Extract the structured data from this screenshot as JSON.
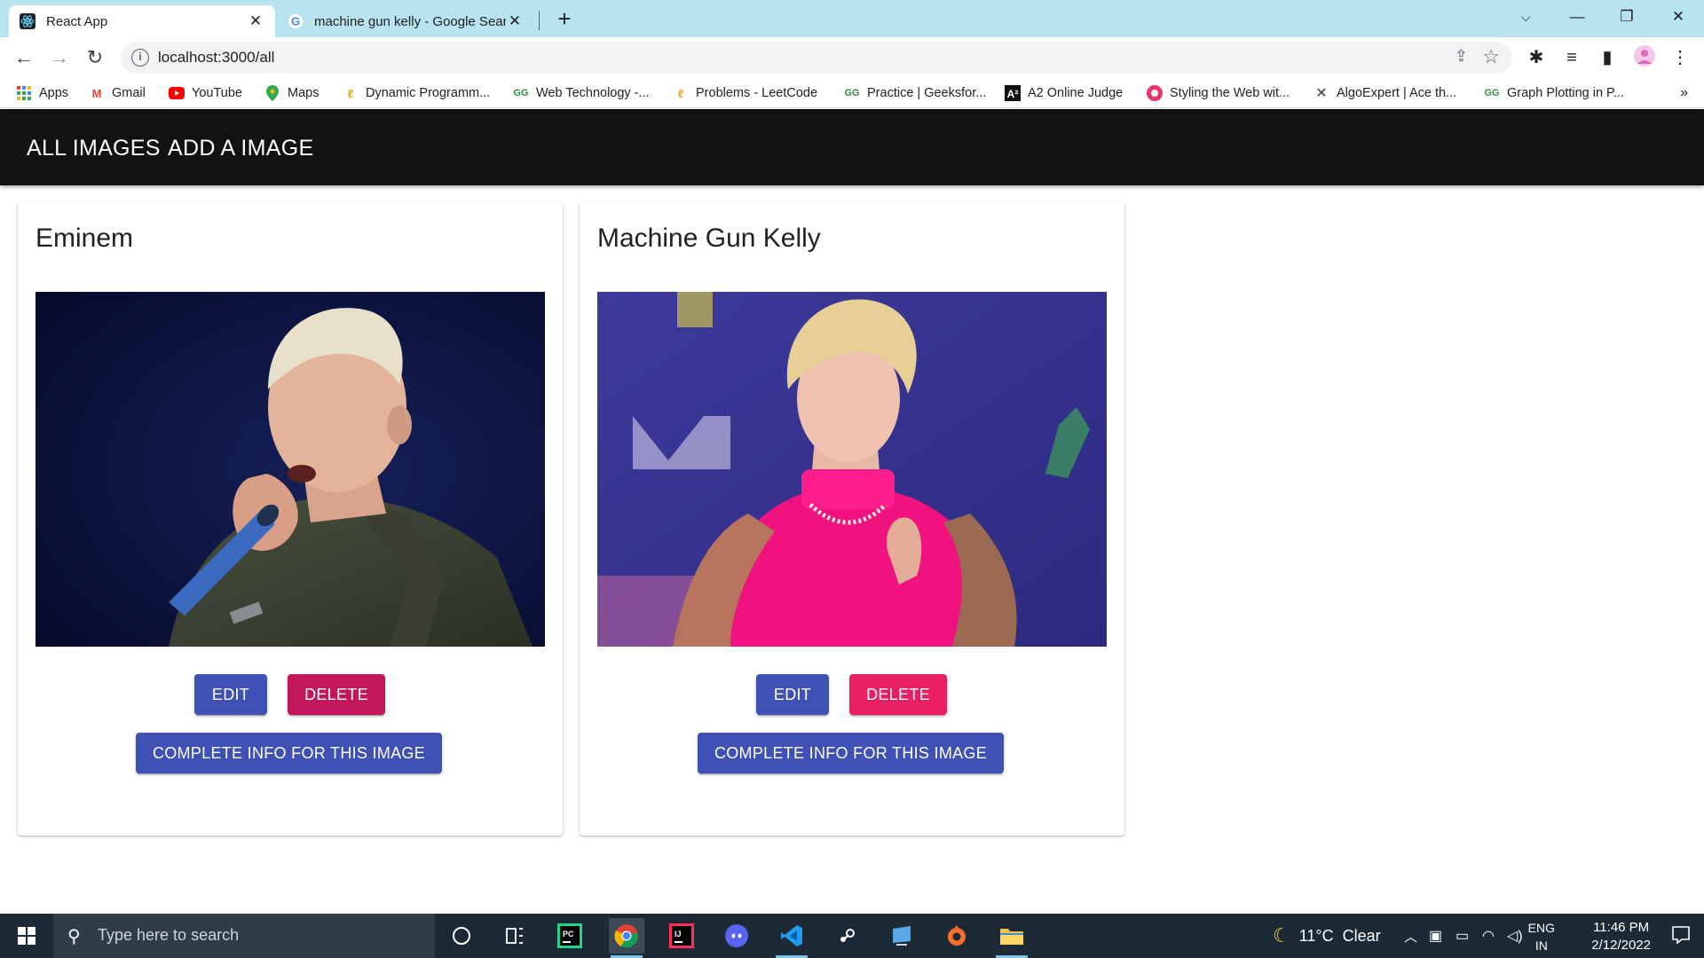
{
  "browser": {
    "tabs": [
      {
        "title": "React App",
        "favicon": "react-icon"
      },
      {
        "title": "machine gun kelly - Google Search",
        "favicon": "google-icon"
      }
    ],
    "new_tab_label": "+",
    "url": "localhost:3000/all",
    "bookmarks": [
      {
        "label": "Apps",
        "icon": "apps-grid-icon"
      },
      {
        "label": "Gmail",
        "icon": "gmail-icon"
      },
      {
        "label": "YouTube",
        "icon": "youtube-icon"
      },
      {
        "label": "Maps",
        "icon": "maps-icon"
      },
      {
        "label": "Dynamic Programm...",
        "icon": "leetcode-icon"
      },
      {
        "label": "Web Technology -...",
        "icon": "gfg-icon"
      },
      {
        "label": "Problems - LeetCode",
        "icon": "leetcode-icon"
      },
      {
        "label": "Practice | Geeksfor...",
        "icon": "gfg-icon"
      },
      {
        "label": "A2 Online Judge",
        "icon": "a2-icon"
      },
      {
        "label": "Styling the Web wit...",
        "icon": "styling-icon"
      },
      {
        "label": "AlgoExpert | Ace th...",
        "icon": "algoexpert-icon"
      },
      {
        "label": "Graph Plotting in P...",
        "icon": "gfg-icon"
      }
    ],
    "bookmarks_more": "»"
  },
  "app": {
    "nav": {
      "all_images": "ALL IMAGES",
      "add_image": "ADD A IMAGE"
    },
    "cards": [
      {
        "name": "Eminem",
        "edit_label": "EDIT",
        "delete_label": "DELETE",
        "info_label": "COMPLETE INFO FOR THIS IMAGE"
      },
      {
        "name": "Machine Gun Kelly",
        "edit_label": "EDIT",
        "delete_label": "DELETE",
        "info_label": "COMPLETE INFO FOR THIS IMAGE"
      }
    ]
  },
  "taskbar": {
    "search_placeholder": "Type here to search",
    "weather": "11°C  Clear",
    "lang_line1": "ENG",
    "lang_line2": "IN",
    "time": "11:46 PM",
    "date": "2/12/2022"
  },
  "colors": {
    "primary": "#3f51b5",
    "secondary": "#e91e63",
    "appbar": "#121212",
    "tabstrip": "#b7e3ee"
  }
}
